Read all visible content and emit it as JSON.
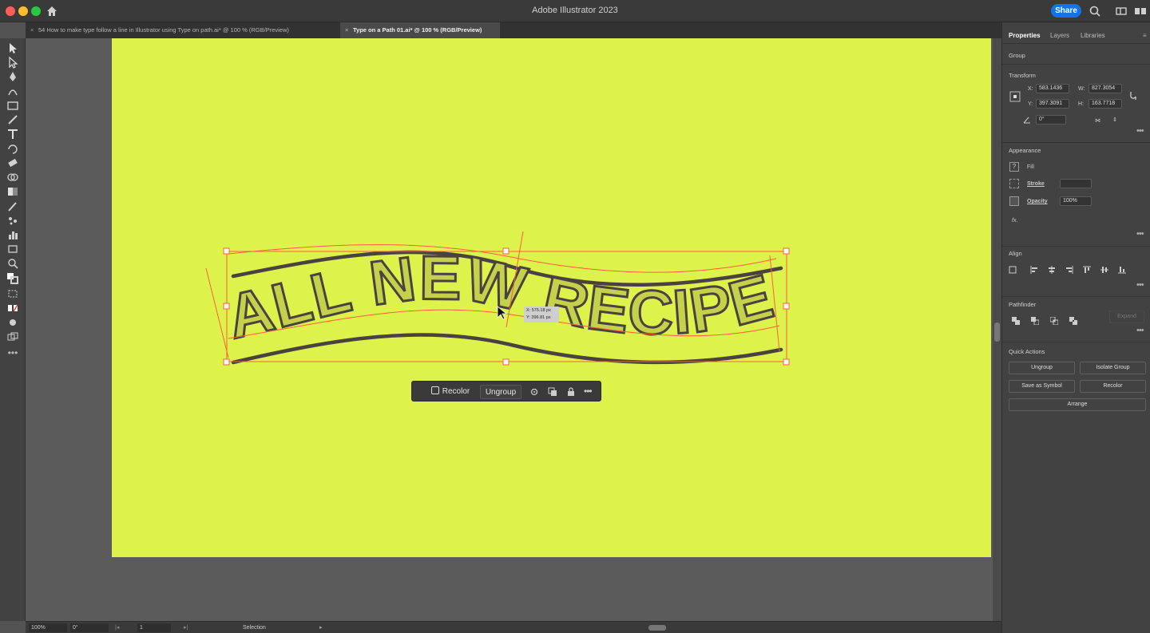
{
  "app": {
    "title": "Adobe Illustrator 2023",
    "share_label": "Share"
  },
  "tabs": [
    {
      "label": "54 How to make type follow a line in Illustrator using Type on path.ai* @ 100 % (RGB/Preview)",
      "active": false
    },
    {
      "label": "Type on a Path 01.ai* @ 100 % (RGB/Preview)",
      "active": true
    }
  ],
  "colors": {
    "artboard": "#ddf24b",
    "text_fill": "#c3d24a",
    "text_stroke": "#4a4240",
    "selection": "#ff5f3a",
    "accent": "#1473e6"
  },
  "artwork": {
    "text": "ALL NEW RECIPE"
  },
  "cursor_readout": {
    "x": "X: 575.18 px",
    "y": "Y: 396.81 px"
  },
  "context_bar": {
    "recolor_label": "Recolor",
    "ungroup_label": "Ungroup"
  },
  "panel": {
    "tabs": [
      "Properties",
      "Layers",
      "Libraries"
    ],
    "selection_type": "Group",
    "transform": {
      "title": "Transform",
      "x_label": "X:",
      "x": "583.1436",
      "y_label": "Y:",
      "y": "397.3091",
      "w_label": "W:",
      "w": "827.3054",
      "h_label": "H:",
      "h": "163.7718",
      "angle": "0°"
    },
    "appearance": {
      "title": "Appearance",
      "fill_label": "Fill",
      "stroke_label": "Stroke",
      "opacity_label": "Opacity",
      "opacity": "100%",
      "fx_label": "fx."
    },
    "align": {
      "title": "Align"
    },
    "pathfinder": {
      "title": "Pathfinder",
      "expand_label": "Expand"
    },
    "quick_actions": {
      "title": "Quick Actions",
      "ungroup": "Ungroup",
      "isolate": "Isolate Group",
      "save_symbol": "Save as Symbol",
      "recolor": "Recolor",
      "arrange": "Arrange"
    }
  },
  "status": {
    "zoom": "100%",
    "rotation": "0°",
    "artboard": "1",
    "tool": "Selection"
  }
}
